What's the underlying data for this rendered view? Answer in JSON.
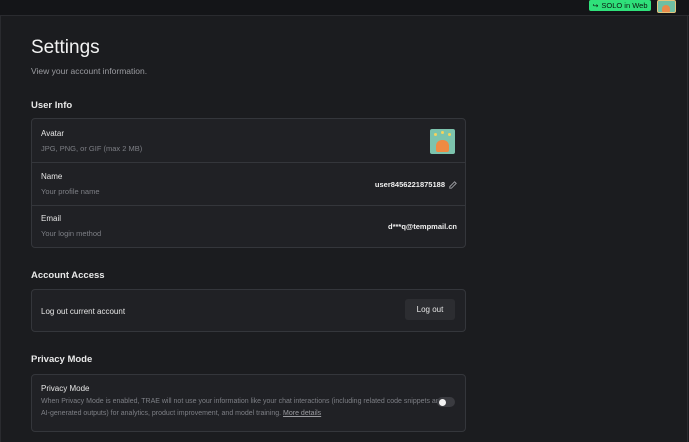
{
  "topbar": {
    "solo_button_label": "SOLO in Web"
  },
  "header": {
    "title": "Settings",
    "subtitle": "View your account information."
  },
  "user_info": {
    "section_title": "User Info",
    "avatar": {
      "label": "Avatar",
      "desc": "JPG, PNG, or GIF (max 2 MB)"
    },
    "name": {
      "label": "Name",
      "desc": "Your profile name",
      "value": "user8456221875188"
    },
    "email": {
      "label": "Email",
      "desc": "Your login method",
      "value": "d***q@tempmail.cn"
    }
  },
  "account_access": {
    "section_title": "Account Access",
    "label": "Log out current account",
    "button_label": "Log out"
  },
  "privacy": {
    "section_title": "Privacy Mode",
    "label": "Privacy Mode",
    "desc": "When Privacy Mode is enabled, TRAE will not use your information like your chat interactions (including related code snippets and AI-generated outputs) for analytics, product improvement, and model training.",
    "link_label": "More details",
    "enabled": false
  },
  "colors": {
    "accent_green": "#2fe07a",
    "background": "#1b1c1f",
    "card": "#202125"
  }
}
